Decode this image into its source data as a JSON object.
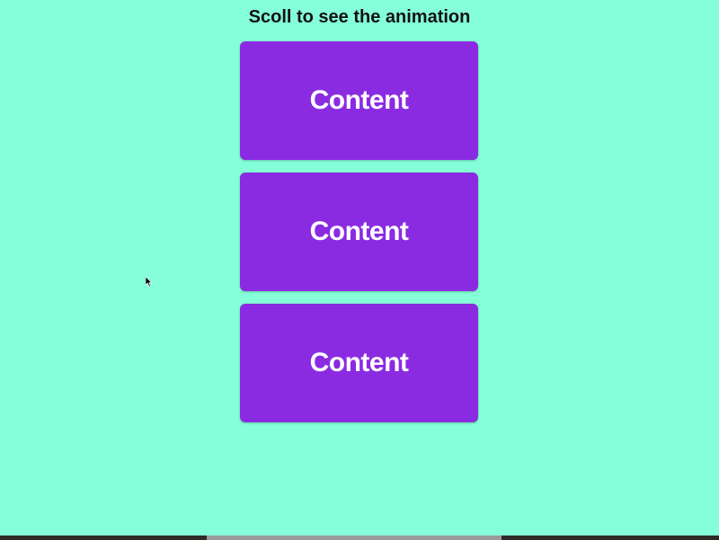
{
  "page": {
    "title": "Scoll to see the animation"
  },
  "cards": [
    {
      "label": "Content"
    },
    {
      "label": "Content"
    },
    {
      "label": "Content"
    }
  ],
  "colors": {
    "background": "#84ffd7",
    "card": "#8a2be2",
    "card_text": "#ffffff",
    "title_text": "#111111"
  },
  "icons": {
    "cursor": "mouse-pointer-icon"
  }
}
